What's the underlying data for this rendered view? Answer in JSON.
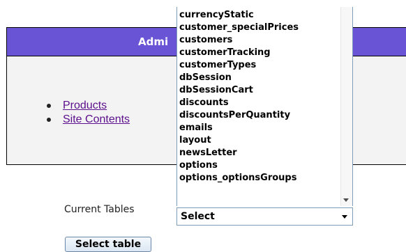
{
  "admin": {
    "title": "Admi",
    "links": [
      "Products",
      "Site Contents"
    ]
  },
  "tables": {
    "label": "Current Tables",
    "options": [
      "currencyStatic",
      "customer_specialPrices",
      "customers",
      "customerTracking",
      "customerTypes",
      "dbSession",
      "dbSessionCart",
      "discounts",
      "discountsPerQuantity",
      "emails",
      "layout",
      "newsLetter",
      "options",
      "options_optionsGroups"
    ],
    "selected": "Select",
    "button_label": "Select table"
  },
  "colors": {
    "header_bg": "#6a54d6",
    "link": "#5b0f8c"
  }
}
